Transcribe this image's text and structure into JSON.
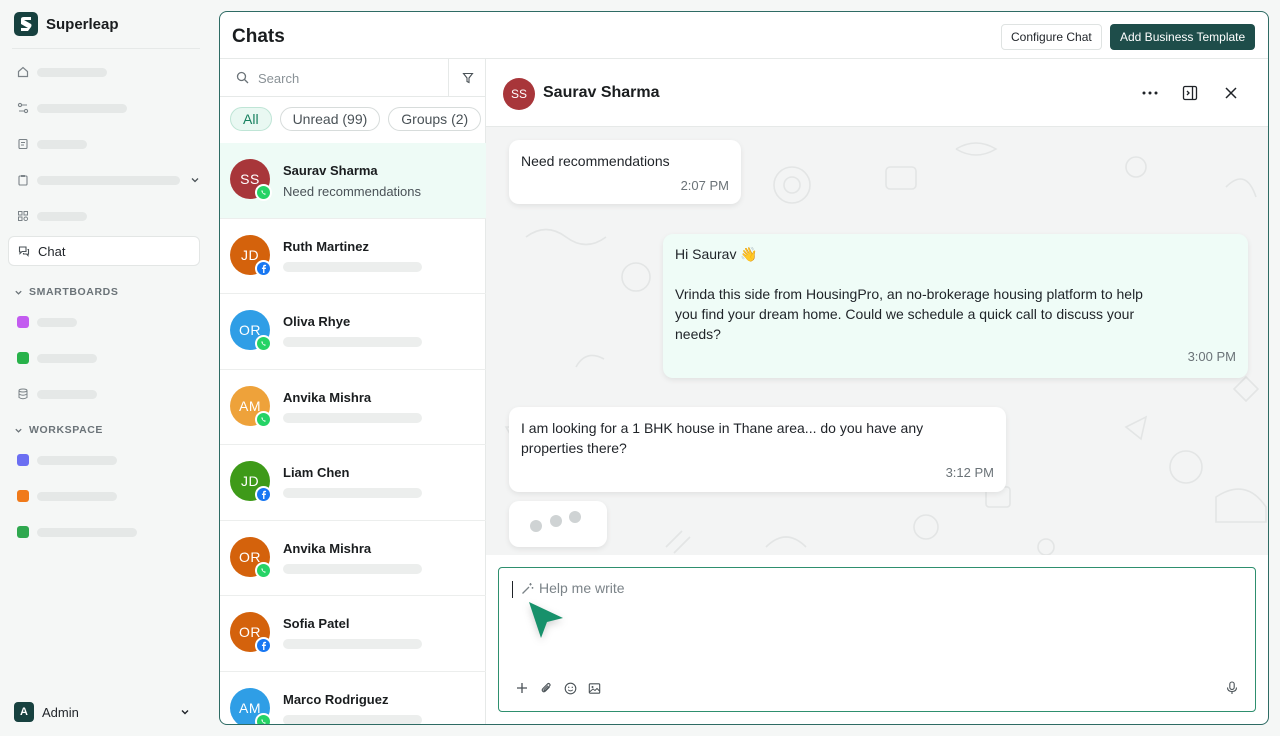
{
  "brand": {
    "name": "Superleap"
  },
  "sidebar": {
    "active_label": "Chat",
    "sections": {
      "smartboards": "SMARTBOARDS",
      "workspace": "WORKSPACE"
    },
    "admin": {
      "initial": "A",
      "name": "Admin"
    },
    "colors": {
      "smartboard1": "#c35cf0",
      "smartboard2": "#28b24a",
      "workspace1": "#6b6ff2",
      "workspace2": "#f07a1a",
      "workspace3": "#2fa84f"
    }
  },
  "header": {
    "title": "Chats",
    "configure_label": "Configure Chat",
    "add_template_label": "Add Business Template"
  },
  "chat_list": {
    "search_placeholder": "Search",
    "filters": [
      {
        "label": "All",
        "active": true
      },
      {
        "label": "Unread (99)",
        "active": false
      },
      {
        "label": "Groups (2)",
        "active": false
      }
    ],
    "items": [
      {
        "initials": "SS",
        "name": "Saurav Sharma",
        "preview": "Need recommendations",
        "channel": "whatsapp",
        "color": "#a8363a"
      },
      {
        "initials": "JD",
        "name": "Ruth Martinez",
        "channel": "facebook",
        "color": "#d4620c"
      },
      {
        "initials": "OR",
        "name": "Oliva Rhye",
        "channel": "whatsapp",
        "color": "#2f9ee6"
      },
      {
        "initials": "AM",
        "name": "Anvika Mishra",
        "channel": "whatsapp",
        "color": "#eea23a"
      },
      {
        "initials": "JD",
        "name": "Liam Chen",
        "channel": "facebook",
        "color": "#3e9a19"
      },
      {
        "initials": "OR",
        "name": "Anvika Mishra",
        "channel": "whatsapp",
        "color": "#d4620c"
      },
      {
        "initials": "OR",
        "name": "Sofia Patel",
        "channel": "facebook",
        "color": "#d4620c"
      },
      {
        "initials": "AM",
        "name": "Marco Rodriguez",
        "channel": "whatsapp",
        "color": "#2f9ee6"
      }
    ]
  },
  "conversation": {
    "contact_initials": "SS",
    "contact_name": "Saurav Sharma",
    "messages": [
      {
        "text": "Need recommendations",
        "time": "2:07 PM"
      },
      {
        "greeting": "Hi Saurav 👋",
        "line1": "Vrinda this side from HousingPro, an no-brokerage housing platform to help",
        "line2": "you find your dream home. Could we schedule a quick call to discuss your",
        "line3": "needs?",
        "time": "3:00 PM"
      },
      {
        "line1": "I am looking for a 1 BHK house in Thane area... do you have any",
        "line2": "properties there?",
        "time": "3:12 PM"
      }
    ],
    "composer_placeholder": "Help me write"
  }
}
